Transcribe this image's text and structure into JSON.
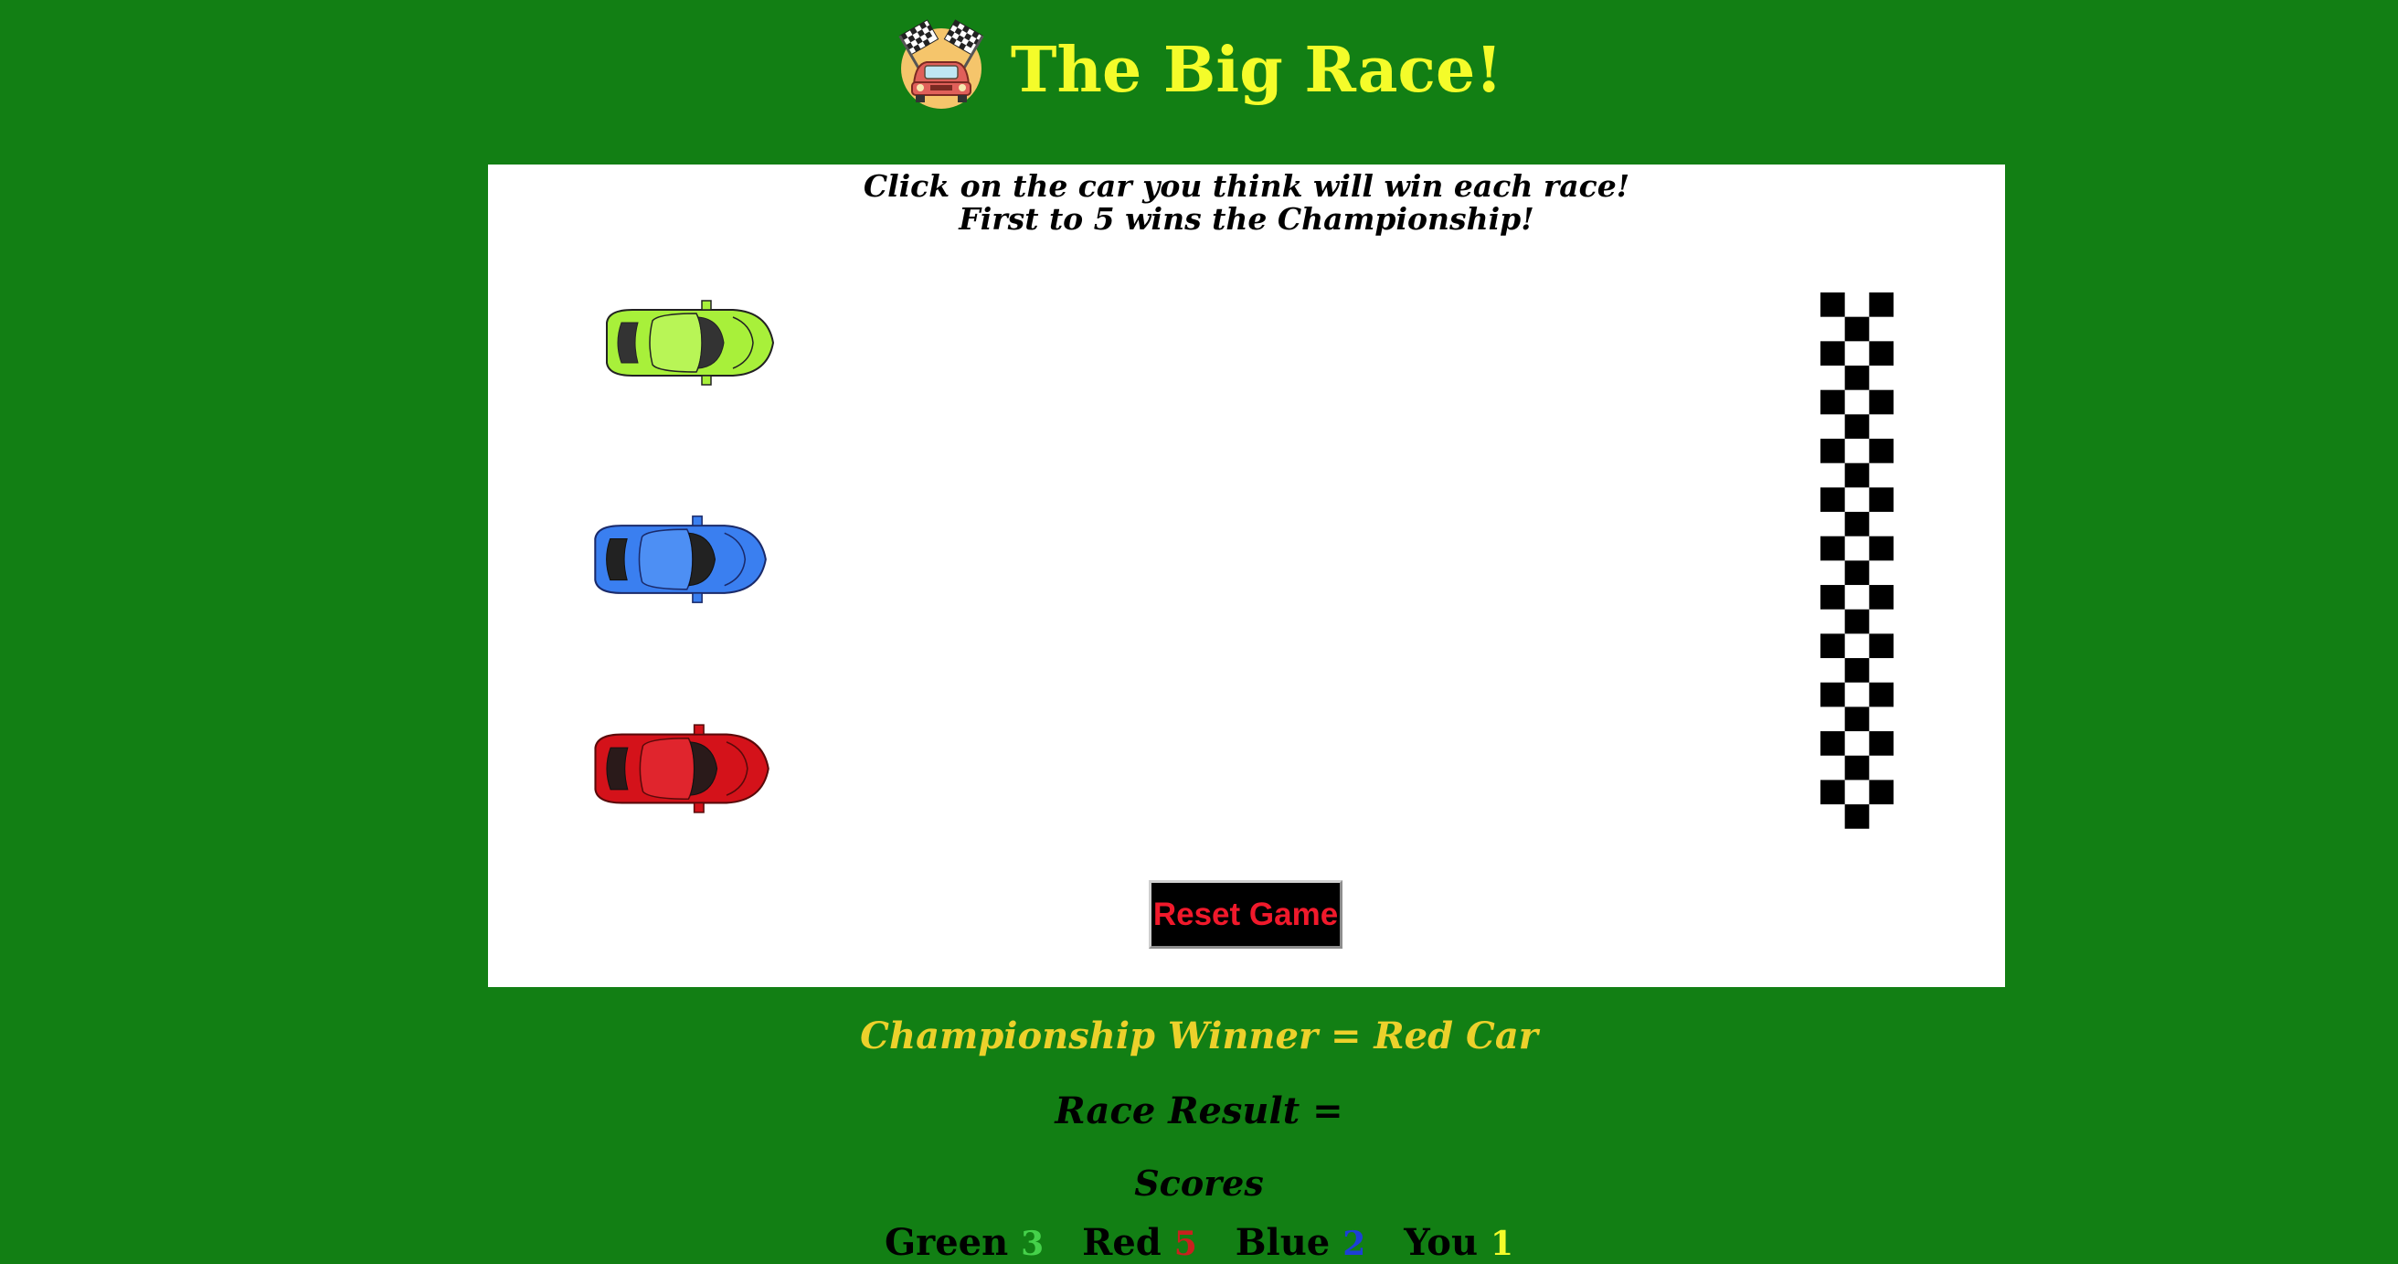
{
  "header": {
    "title": "The Big Race!",
    "logo_icon": "racing-car-checkered-flags-icon"
  },
  "board": {
    "instruction_line1": "Click on the car you think will win each race!",
    "instruction_line2": "First to 5 wins the Championship!",
    "cars": [
      {
        "name": "Green",
        "color": "#a8f03a"
      },
      {
        "name": "Blue",
        "color": "#3a7ff0"
      },
      {
        "name": "Red",
        "color": "#d4121a"
      }
    ],
    "finish_line_icon": "checkered-finish-line"
  },
  "reset_label": "Reset Game",
  "championship": "Championship Winner = Red Car",
  "race_result": "Race Result =",
  "scores_title": "Scores",
  "scores": [
    {
      "label": "Green",
      "value": "3",
      "color": "#45d14a"
    },
    {
      "label": "Red",
      "value": "5",
      "color": "#c8211e"
    },
    {
      "label": "Blue",
      "value": "2",
      "color": "#1d3fd6"
    },
    {
      "label": "You",
      "value": "1",
      "color": "#f4fc2a"
    }
  ],
  "colors": {
    "background": "#127f14",
    "title": "#f4fc2a",
    "championship": "#ecd12b",
    "reset_text": "#f0192b"
  }
}
